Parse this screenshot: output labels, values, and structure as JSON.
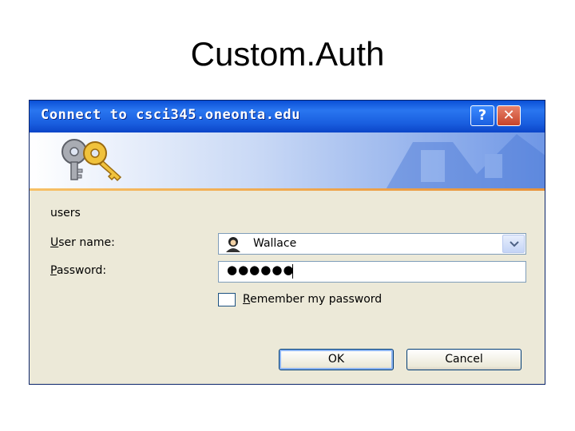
{
  "slide": {
    "title": "Custom.Auth"
  },
  "dialog": {
    "title": "Connect to csci345.oneonta.edu",
    "help_label": "?",
    "close_label": "✕",
    "realm": "users",
    "username_label": {
      "accel": "U",
      "rest": "ser name:"
    },
    "username_value": "Wallace",
    "password_label": {
      "accel": "P",
      "rest": "assword:"
    },
    "password_dots": "●●●●●●",
    "remember_label": {
      "accel": "R",
      "rest": "emember my password"
    },
    "remember_checked": false,
    "ok_label": "OK",
    "cancel_label": "Cancel",
    "icons": {
      "banner": "keys-icon",
      "user": "user-icon",
      "dropdown": "chevron-down-icon"
    },
    "colors": {
      "titlebar": "#0a4fd6",
      "body": "#ece9d8",
      "accent_line": "#e8923a"
    }
  }
}
